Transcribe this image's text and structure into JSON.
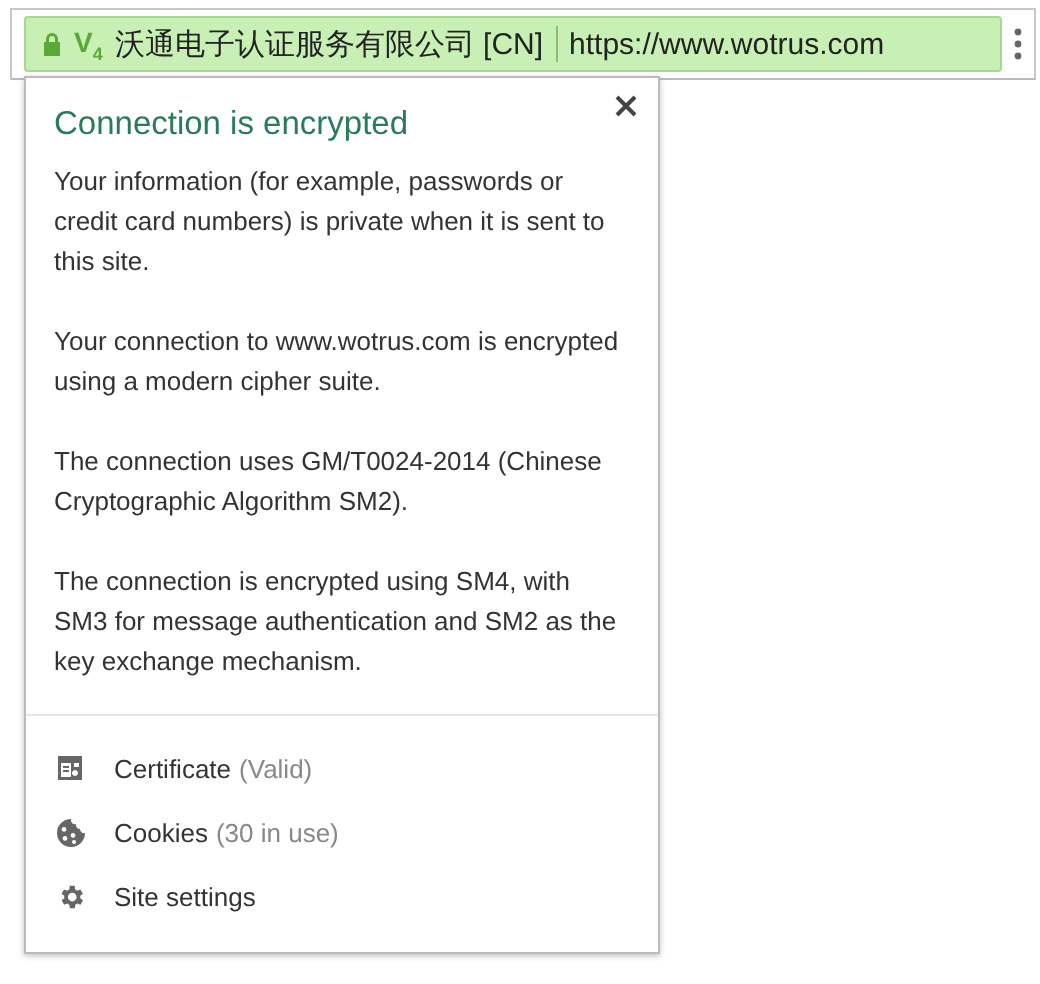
{
  "address_bar": {
    "secure": true,
    "badge": "V$_{4}$",
    "organization": "沃通电子认证服务有限公司 [CN]",
    "url": "https://www.wotrus.com"
  },
  "popup": {
    "title": "Connection is encrypted",
    "paragraphs": [
      "Your information (for example, passwords or credit card numbers) is private when it is sent to this site.",
      "Your connection to www.wotrus.com is encrypted using a modern cipher suite.",
      "The connection uses GM/T0024-2014 (Chinese Cryptographic Algorithm SM2).",
      "The connection is encrypted using SM4, with SM3 for message authentication and SM2 as the key exchange mechanism."
    ],
    "items": [
      {
        "kind": "certificate",
        "label": "Certificate",
        "detail": "(Valid)"
      },
      {
        "kind": "cookies",
        "label": "Cookies",
        "detail": "(30 in use)"
      },
      {
        "kind": "settings",
        "label": "Site settings"
      }
    ]
  }
}
